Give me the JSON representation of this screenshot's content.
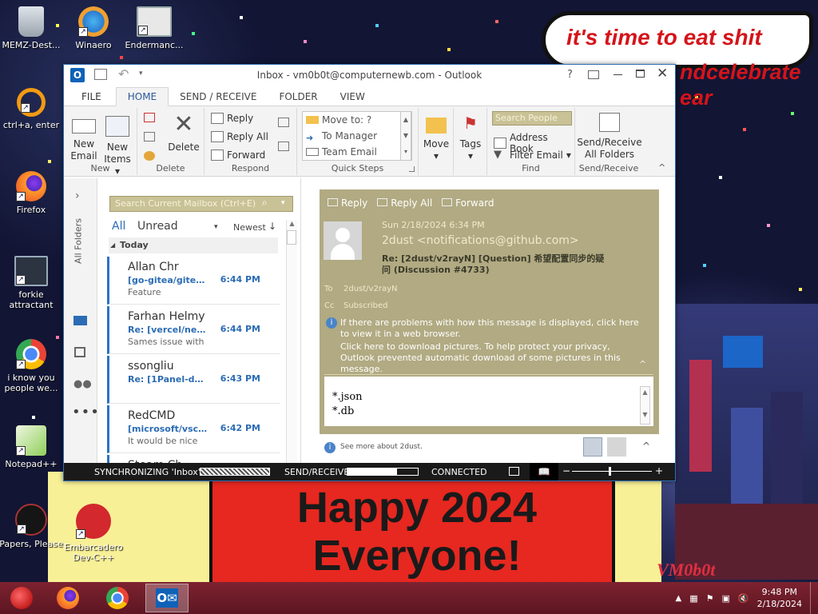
{
  "desktop": {
    "icons": [
      {
        "label": "MEMZ-Dest...",
        "icon": "recycle-bin-icon"
      },
      {
        "label": "Winaero",
        "icon": "winaero-icon"
      },
      {
        "label": "Endermanc...",
        "icon": "program-window-icon"
      },
      {
        "label": "ctrl+a, enter",
        "icon": "orange-ring-icon"
      },
      {
        "label": "Firefox",
        "icon": "firefox-icon"
      },
      {
        "label": "forkie attractant",
        "icon": "monitor-gear-icon"
      },
      {
        "label": "i know you people we...",
        "icon": "chrome-icon"
      },
      {
        "label": "Notepad++",
        "icon": "notepadpp-icon"
      },
      {
        "label": "Papers, Please",
        "icon": "papers-please-icon"
      },
      {
        "label": "Embarcadero Dev-C++",
        "icon": "devcpp-icon"
      }
    ],
    "bubble_line1": "it's time to eat shit",
    "bubble_line2": "ndcelebrate",
    "bubble_line3": "ear",
    "banner_line1": "Happy 2024",
    "banner_line2": "Everyone!",
    "signature": "VM0b0t"
  },
  "outlook": {
    "title": "Inbox - vm0b0t@computernewb.com - Outlook",
    "help": "?",
    "tabs": [
      "FILE",
      "HOME",
      "SEND / RECEIVE",
      "FOLDER",
      "VIEW"
    ],
    "ribbon": {
      "new_email": "New Email",
      "new_email_1": "New",
      "new_email_2": "Email",
      "new_items_1": "New",
      "new_items_2": "Items",
      "group_new": "New",
      "delete": "Delete",
      "group_delete": "Delete",
      "reply": "Reply",
      "reply_all": "Reply All",
      "forward": "Forward",
      "group_respond": "Respond",
      "quick_steps": [
        "Move to: ?",
        "To Manager",
        "Team Email"
      ],
      "group_quick_steps": "Quick Steps",
      "move": "Move",
      "tags": "Tags",
      "search_people": "Search People",
      "address_book": "Address Book",
      "filter_email": "Filter Email",
      "group_find": "Find",
      "send_receive_1": "Send/Receive",
      "send_receive_2": "All Folders",
      "group_send_receive": "Send/Receive"
    },
    "sidebar": {
      "all_folders": "All Folders"
    },
    "list": {
      "search_placeholder": "Search Current Mailbox (Ctrl+E)",
      "filter_all": "All",
      "filter_unread": "Unread",
      "sort": "Newest",
      "group_today": "Today",
      "mails": [
        {
          "sender": "Allan Chr",
          "subject": "[go-gitea/gitea]...",
          "time": "6:44 PM",
          "preview": "Feature"
        },
        {
          "sender": "Farhan Helmy",
          "subject": "Re: [vercel/next...",
          "time": "6:44 PM",
          "preview": "Sames issue with"
        },
        {
          "sender": "ssongliu",
          "subject": "Re: [1Panel-dev...",
          "time": "6:43 PM",
          "preview": ""
        },
        {
          "sender": "RedCMD",
          "subject": "[microsoft/vsco...",
          "time": "6:42 PM",
          "preview": "It would be nice"
        },
        {
          "sender": "Steam Ch",
          "subject": "",
          "time": "",
          "preview": ""
        }
      ]
    },
    "reading": {
      "reply": "Reply",
      "reply_all": "Reply All",
      "forward": "Forward",
      "date": "Sun 2/18/2024 6:34 PM",
      "from": "2dust <notifications@github.com>",
      "subject": "Re: [2dust/v2rayN] [Question] 希望配置同步的疑问 (Discussion #4733)",
      "to_label": "To",
      "to_value": "2dust/v2rayN",
      "cc_label": "Cc",
      "cc_value": "Subscribed",
      "info1": "If there are problems with how this message is displayed, click here to view it in a web browser.",
      "info2": "Click here to download pictures. To help protect your privacy, Outlook prevented automatic download of some pictures in this message.",
      "body1": "*.json",
      "body2": "*.db",
      "footer": "See more about 2dust."
    },
    "status": {
      "sync": "SYNCHRONIZING 'Inbox'",
      "send_receive": "SEND/RECEIVE",
      "connected": "CONNECTED",
      "sync_progress": 1.0,
      "send_progress": 0.7
    }
  },
  "taskbar": {
    "time": "9:48 PM",
    "date": "2/18/2024"
  }
}
